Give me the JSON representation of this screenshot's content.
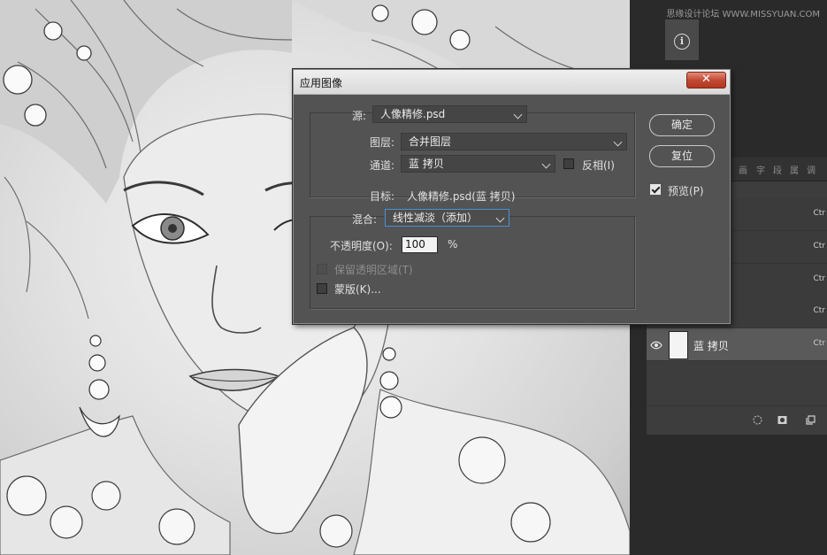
{
  "watermark": "思缘设计论坛 WWW.MISSYUAN.COM",
  "dialog": {
    "title": "应用图像",
    "close_symbol": "✕",
    "source_label": "源:",
    "source_value": "人像精修.psd",
    "layer_label": "图层:",
    "layer_value": "合并图层",
    "channel_label": "通道:",
    "channel_value": "蓝 拷贝",
    "invert_label": "反相(I)",
    "target_label": "目标:",
    "target_value": "人像精修.psd(蓝 拷贝)",
    "blend_label": "混合:",
    "blend_value": "线性减淡（添加）",
    "opacity_label": "不透明度(O):",
    "opacity_value": "100",
    "opacity_unit": "%",
    "preserve_label": "保留透明区域(T)",
    "mask_label": "蒙版(K)...",
    "ok_label": "确定",
    "reset_label": "复位",
    "preview_label": "预览(P)",
    "preview_checked": true,
    "invert_checked": false
  },
  "layers_panel": {
    "tabs": [
      "画",
      "字",
      "段",
      "属",
      "调"
    ],
    "rows": [
      {
        "ctrl": "Ctr"
      },
      {
        "ctrl": "Ctr"
      },
      {
        "ctrl": "Ctr"
      },
      {
        "ctrl": "Ctr"
      }
    ],
    "active_layer": {
      "name": "蓝 拷贝",
      "ctrl": "Ctr"
    }
  },
  "icons": [
    "info-icon",
    "eye-icon",
    "selection-icon",
    "mask-icon",
    "new-layer-icon",
    "close-icon",
    "chevron-down-icon"
  ],
  "colors": {
    "dialog_bg": "#535353",
    "title_bar": "#e4e4e4",
    "close_red": "#c24a35",
    "focus_blue": "#4a90d9",
    "panel_bg": "#3d3d3d"
  }
}
